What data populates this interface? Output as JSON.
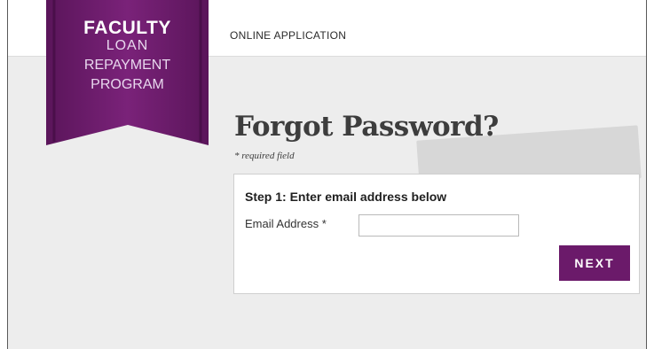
{
  "header": {
    "title": "ONLINE APPLICATION"
  },
  "logo": {
    "line1": "FACULTY",
    "line2": "LOAN",
    "line3": "REPAYMENT",
    "line4": "PROGRAM",
    "color": "#6b1a6a"
  },
  "main": {
    "title": "Forgot Password?",
    "required_note": "* required field"
  },
  "form": {
    "step_heading": "Step 1: Enter email address below",
    "email_label": "Email Address *",
    "email_value": "",
    "email_placeholder": "",
    "next_label": "NEXT"
  },
  "colors": {
    "brand": "#6b1a6a",
    "background": "#ededed"
  }
}
